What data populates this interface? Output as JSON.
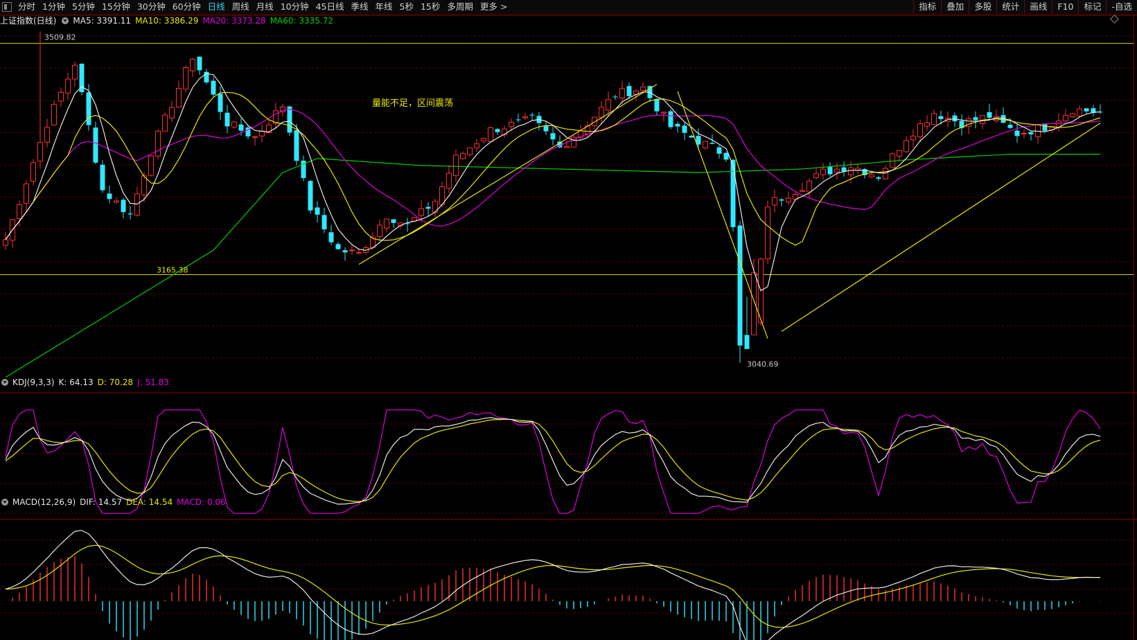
{
  "toolbar": {
    "periods": [
      "分时",
      "1分钟",
      "5分钟",
      "15分钟",
      "30分钟",
      "60分钟",
      "日线",
      "周线",
      "月线",
      "10分钟",
      "45日线",
      "季线",
      "年线",
      "5秒",
      "15秒",
      "多周期",
      "更多 >"
    ],
    "active": "日线",
    "right_buttons": [
      "指标",
      "叠加",
      "多股",
      "统计",
      "画线",
      "F10",
      "标记",
      "-自选"
    ]
  },
  "main_panel": {
    "symbol": "上证指数(日线)",
    "ma": [
      {
        "label": "MA5: 3391.11",
        "color": "#e8e8e8"
      },
      {
        "label": "MA10: 3386.29",
        "color": "#e8e800"
      },
      {
        "label": "MA20: 3373.28",
        "color": "#e000e0"
      },
      {
        "label": "MA60: 3335.72",
        "color": "#00d000"
      }
    ],
    "annotation": "量能不足，区间震荡",
    "high_label": "3509.82",
    "low_label": "3040.69",
    "support_label": "3165.38"
  },
  "kdj_panel": {
    "name": "KDJ(9,3,3)",
    "k": "K: 64.13",
    "d": "D: 70.28",
    "j": "J: 51.83"
  },
  "macd_panel": {
    "name": "MACD(12,26,9)",
    "dif": "DIF: 14.57",
    "dea": "DEA: 14.54",
    "macd": "MACD: 0.06"
  },
  "chart_data": {
    "type": "candlestick",
    "ylim": [
      3005,
      3525
    ],
    "resistance": 3493,
    "support": 3165.38,
    "high": 3509.82,
    "low": 3040.69,
    "close_anchors": [
      [
        0,
        3215
      ],
      [
        6,
        3380
      ],
      [
        10,
        3465
      ],
      [
        14,
        3285
      ],
      [
        18,
        3250
      ],
      [
        21,
        3340
      ],
      [
        27,
        3475
      ],
      [
        32,
        3380
      ],
      [
        36,
        3360
      ],
      [
        40,
        3405
      ],
      [
        44,
        3260
      ],
      [
        48,
        3200
      ],
      [
        51,
        3195
      ],
      [
        55,
        3250
      ],
      [
        58,
        3235
      ],
      [
        62,
        3270
      ],
      [
        65,
        3330
      ],
      [
        70,
        3370
      ],
      [
        76,
        3385
      ],
      [
        80,
        3345
      ],
      [
        84,
        3380
      ],
      [
        88,
        3420
      ],
      [
        92,
        3430
      ],
      [
        96,
        3375
      ],
      [
        100,
        3355
      ],
      [
        104,
        3335
      ],
      [
        106,
        3140
      ],
      [
        108,
        3100
      ],
      [
        110,
        3265
      ],
      [
        114,
        3285
      ],
      [
        118,
        3310
      ],
      [
        122,
        3320
      ],
      [
        126,
        3305
      ],
      [
        130,
        3360
      ],
      [
        134,
        3395
      ],
      [
        138,
        3380
      ],
      [
        142,
        3390
      ],
      [
        146,
        3365
      ],
      [
        150,
        3375
      ],
      [
        154,
        3400
      ],
      [
        158,
        3395
      ]
    ],
    "ma60_anchors": [
      [
        0,
        3020
      ],
      [
        15,
        3110
      ],
      [
        30,
        3200
      ],
      [
        40,
        3310
      ],
      [
        45,
        3330
      ],
      [
        60,
        3320
      ],
      [
        80,
        3315
      ],
      [
        100,
        3310
      ],
      [
        115,
        3315
      ],
      [
        130,
        3328
      ],
      [
        145,
        3336
      ],
      [
        158,
        3336
      ]
    ],
    "colors": {
      "up": "#ff3030",
      "down": "#30e8ff",
      "ma5": "#e8e8e8",
      "ma10": "#e8e800",
      "ma20": "#e000e0",
      "ma60": "#00d000"
    }
  }
}
